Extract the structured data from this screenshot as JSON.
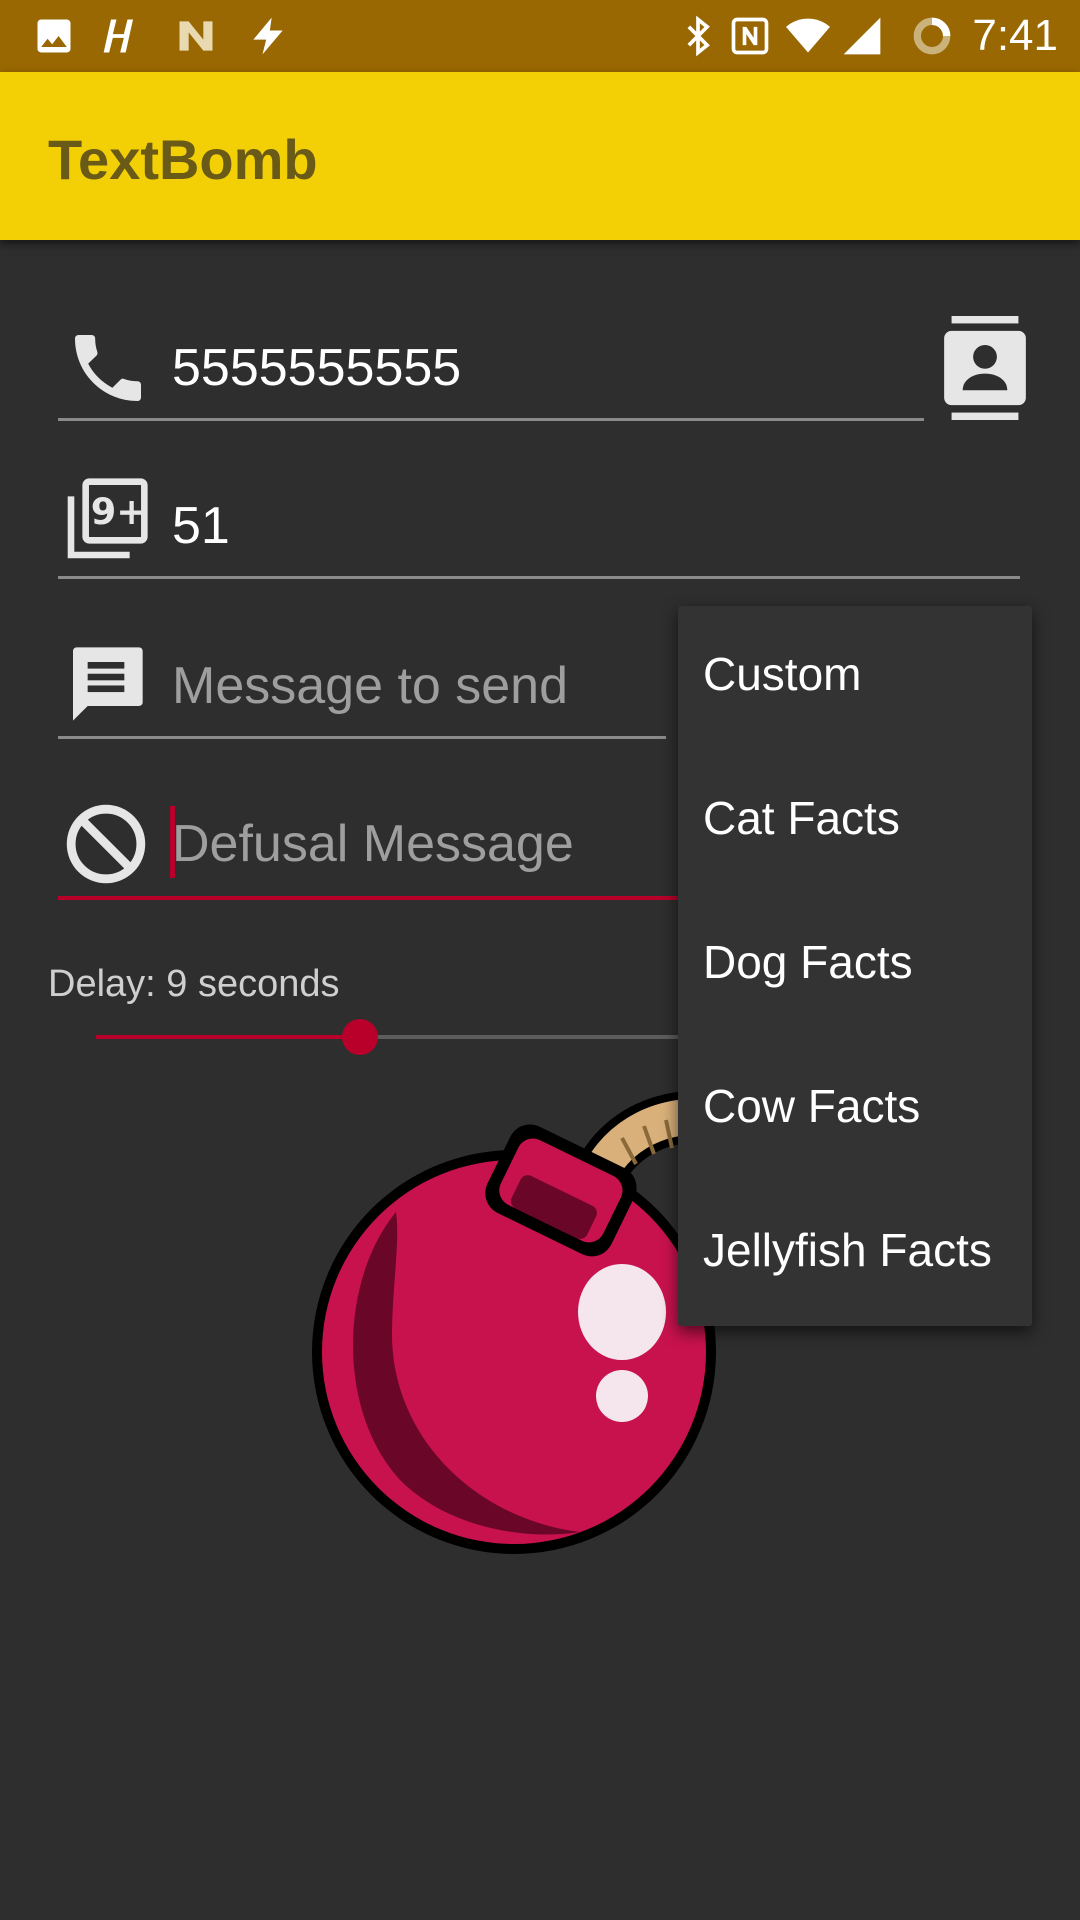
{
  "status_bar": {
    "time": "7:41",
    "icons": [
      "image-icon",
      "hearthstone-icon",
      "n-logo-icon",
      "bolt-icon",
      "bluetooth-icon",
      "nfc-icon",
      "wifi-icon",
      "signal-icon",
      "battery-ring-icon"
    ]
  },
  "app_bar": {
    "title": "TextBomb"
  },
  "fields": {
    "phone": {
      "value": "5555555555",
      "icon": "phone-icon"
    },
    "count": {
      "value": "51",
      "icon": "filter-9-plus-icon"
    },
    "message": {
      "placeholder": "Message to send",
      "icon": "message-icon"
    },
    "defusal": {
      "placeholder": "Defusal Message",
      "icon": "block-icon"
    }
  },
  "contact_button": {
    "icon": "contact-card-icon"
  },
  "delay": {
    "label": "Delay: 9 seconds",
    "fraction": 0.44
  },
  "menu": {
    "items": [
      "Custom",
      "Cat Facts",
      "Dog Facts",
      "Cow Facts",
      "Jellyfish Facts"
    ]
  },
  "colors": {
    "status_bar": "#9a6802",
    "app_bar": "#f3d006",
    "accent": "#b8002a",
    "background": "#2e2e2e",
    "bomb_body": "#c8124e"
  }
}
